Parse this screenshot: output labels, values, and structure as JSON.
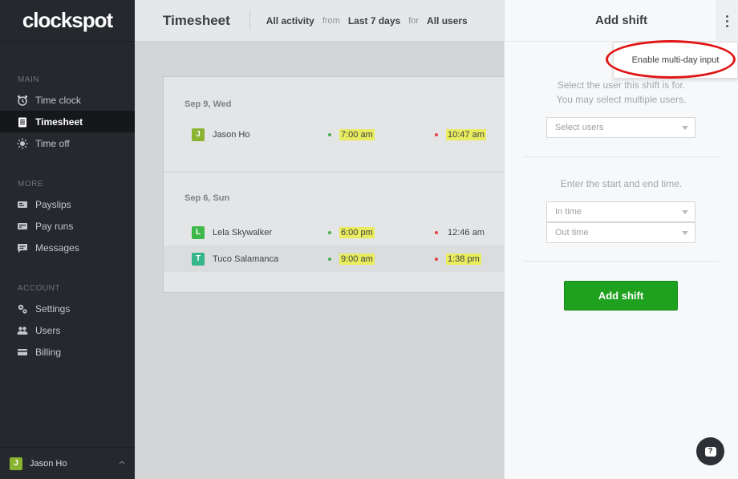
{
  "app": {
    "logo": "clockspot"
  },
  "sidebar": {
    "sections": [
      {
        "label": "MAIN",
        "items": [
          {
            "label": "Time clock",
            "icon": "alarm-clock-icon",
            "active": false
          },
          {
            "label": "Timesheet",
            "icon": "timesheet-icon",
            "active": true
          },
          {
            "label": "Time off",
            "icon": "sun-icon",
            "active": false
          }
        ]
      },
      {
        "label": "MORE",
        "items": [
          {
            "label": "Payslips",
            "icon": "payslip-icon",
            "active": false
          },
          {
            "label": "Pay runs",
            "icon": "pay-run-icon",
            "active": false
          },
          {
            "label": "Messages",
            "icon": "message-icon",
            "active": false
          }
        ]
      },
      {
        "label": "ACCOUNT",
        "items": [
          {
            "label": "Settings",
            "icon": "gears-icon",
            "active": false
          },
          {
            "label": "Users",
            "icon": "users-icon",
            "active": false
          },
          {
            "label": "Billing",
            "icon": "credit-card-icon",
            "active": false
          }
        ]
      }
    ],
    "footer": {
      "user_initial": "J",
      "user_name": "Jason Ho",
      "avatar_color": "#8ab331"
    }
  },
  "header": {
    "title": "Timesheet",
    "filter_activity": "All activity",
    "from_label": "from",
    "filter_range": "Last 7 days",
    "for_label": "for",
    "filter_users": "All users"
  },
  "timesheet": {
    "groups": [
      {
        "date": "Sep 9, Wed",
        "entries": [
          {
            "initial": "J",
            "name": "Jason Ho",
            "avatar_color": "#8ab331",
            "in_time": "7:00 am",
            "in_highlight": true,
            "out_time": "10:47 am",
            "out_highlight": true
          }
        ]
      },
      {
        "date": "Sep 6, Sun",
        "entries": [
          {
            "initial": "L",
            "name": "Lela Skywalker",
            "avatar_color": "#3fb84a",
            "in_time": "6:00 pm",
            "in_highlight": true,
            "out_time": "12:46 am",
            "out_highlight": false
          },
          {
            "initial": "T",
            "name": "Tuco Salamanca",
            "avatar_color": "#35b58a",
            "in_time": "9:00 am",
            "in_highlight": true,
            "out_time": "1:38 pm",
            "out_highlight": true
          }
        ]
      }
    ],
    "colors": {
      "in_dot": "#4caf50",
      "out_dot": "#e04646",
      "highlight": "#e8ec5e"
    }
  },
  "panel": {
    "title": "Add shift",
    "menu_item": "Enable multi-day input",
    "user_help_line1": "Select the user this shift is for.",
    "user_help_line2": "You may select multiple users.",
    "users_placeholder": "Select users",
    "time_help": "Enter the start and end time.",
    "in_time_placeholder": "In time",
    "out_time_placeholder": "Out time",
    "submit_label": "Add shift",
    "help_icon": "question-mark-icon",
    "accent": "#1ea11e"
  }
}
